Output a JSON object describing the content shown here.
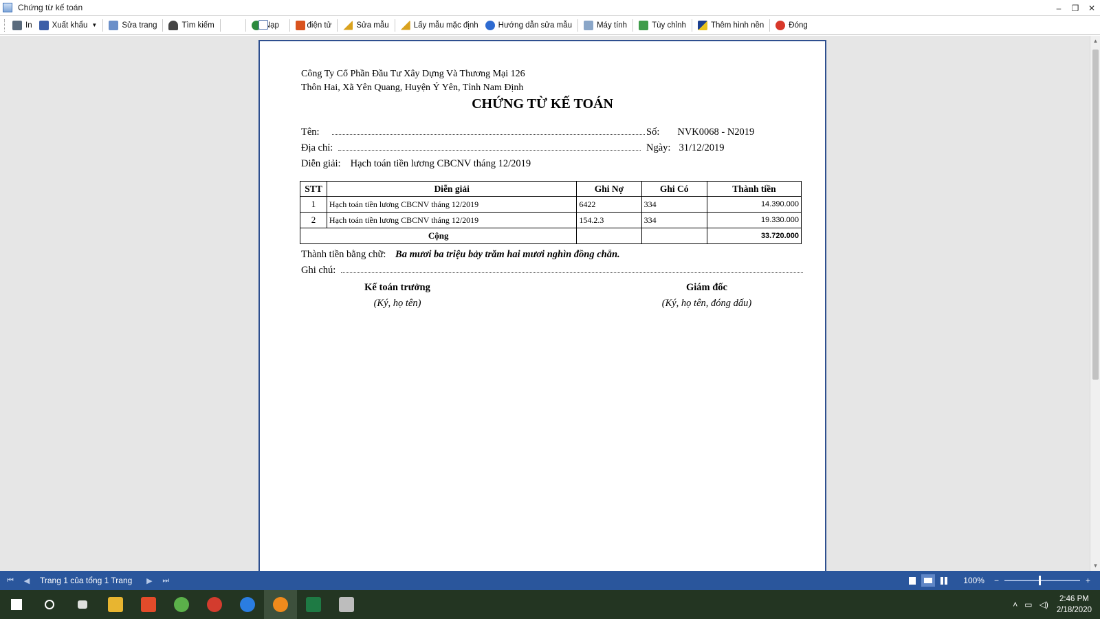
{
  "window": {
    "title": "Chứng từ kế toán",
    "controls": [
      "–",
      "❐",
      "✕"
    ]
  },
  "toolbar": {
    "print": "In",
    "export": "Xuất khẩu",
    "edit_page": "Sửa trang",
    "search": "Tìm kiếm",
    "reload": "Nạp",
    "esign": "Ký điện tử",
    "edit_template": "Sửa mẫu",
    "default_template": "Lấy mẫu mặc định",
    "template_help": "Hướng dẫn sửa mẫu",
    "calculator": "Máy tính",
    "customize": "Tùy chỉnh",
    "wallpaper": "Thêm hình nền",
    "close": "Đóng"
  },
  "document": {
    "company_name": "Công Ty Cổ Phần Đầu Tư Xây Dựng Và Thương Mại 126",
    "company_address": "Thôn Hai, Xã Yên Quang, Huyện Ý Yên, Tỉnh Nam Định",
    "title": "CHỨNG TỪ KẾ TOÁN",
    "name_label": "Tên:",
    "number_label": "Số:",
    "number_value": "NVK0068 - N2019",
    "address_label": "Địa chỉ:",
    "date_label": "Ngày:",
    "date_value": "31/12/2019",
    "description_label": "Diễn giải:",
    "description_value": "Hạch toán tiền lương CBCNV tháng 12/2019",
    "table": {
      "headers": [
        "STT",
        "Diễn giải",
        "Ghi Nợ",
        "Ghi Có",
        "Thành tiền"
      ],
      "rows": [
        {
          "stt": "1",
          "desc": "Hạch toán tiền lương CBCNV tháng 12/2019",
          "debit": "6422",
          "credit": "334",
          "amount": "14.390.000"
        },
        {
          "stt": "2",
          "desc": "Hạch toán tiền lương CBCNV tháng 12/2019",
          "debit": "154.2.3",
          "credit": "334",
          "amount": "19.330.000"
        }
      ],
      "total_label": "Cộng",
      "total_amount": "33.720.000"
    },
    "amount_words_label": "Thành tiền bằng chữ:",
    "amount_words_value": "Ba mươi ba triệu bảy trăm hai mươi nghìn đồng chẵn.",
    "note_label": "Ghi chú:",
    "sign_left_title": "Kế toán trưởng",
    "sign_left_sub": "(Ký, họ tên)",
    "sign_right_title": "Giám đốc",
    "sign_right_sub": "(Ký, họ tên, đóng dấu)"
  },
  "statusbar": {
    "page_info": "Trang 1 của tổng 1 Trang",
    "zoom": "100%",
    "zoom_out": "−",
    "zoom_in": "+"
  },
  "taskbar": {
    "time": "2:46 PM",
    "date": "2/18/2020",
    "apps": [
      "start",
      "search",
      "task-view",
      "file-explorer",
      "store",
      "app-green",
      "chrome",
      "zalo",
      "browser-active",
      "excel",
      "printer"
    ],
    "app_colors": [
      "#ffffff",
      "#ffffff",
      "#ffffff",
      "#e8b530",
      "#e34b2a",
      "#5bb14a",
      "#d33c2e",
      "#2a7de1",
      "#f08a1c",
      "#1e7a44",
      "#bdbdbd"
    ]
  }
}
